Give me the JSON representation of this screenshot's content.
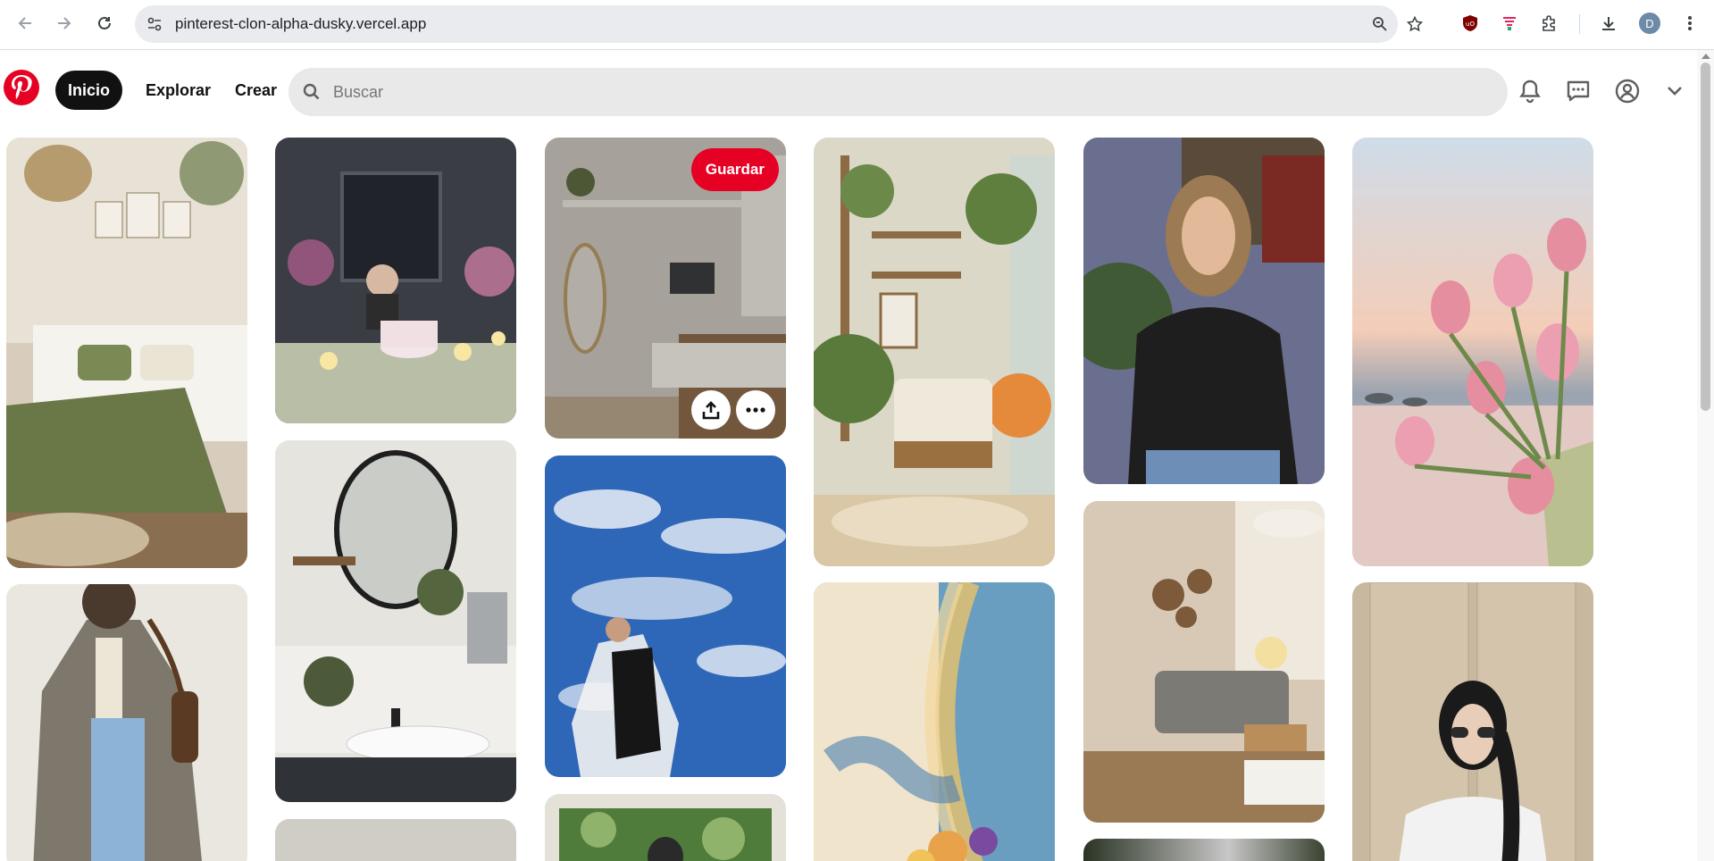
{
  "browser": {
    "url": "pinterest-clon-alpha-dusky.vercel.app",
    "profile_initial": "D"
  },
  "header": {
    "nav": [
      {
        "label": "Inicio",
        "active": true
      },
      {
        "label": "Explorar",
        "active": false
      },
      {
        "label": "Crear",
        "active": false
      }
    ],
    "search_placeholder": "Buscar"
  },
  "pins": {
    "save_label": "Guardar",
    "items": [
      {
        "id": 1,
        "subject": "bedroom",
        "colors": [
          "#d8cdbd",
          "#6a7848"
        ]
      },
      {
        "id": 2,
        "subject": "birthday-cake",
        "colors": [
          "#3a3d44",
          "#b9bfa6"
        ]
      },
      {
        "id": 3,
        "subject": "bedroom-shelves",
        "colors": [
          "#cbc6bd",
          "#8d6b4a"
        ]
      },
      {
        "id": 4,
        "subject": "reading-nook",
        "colors": [
          "#dcd8c8",
          "#8c6a44"
        ]
      },
      {
        "id": 5,
        "subject": "woman-portrait",
        "colors": [
          "#6a6f8f",
          "#1e1e1e"
        ]
      },
      {
        "id": 6,
        "subject": "pink-tulips",
        "colors": [
          "#e7d6d4",
          "#e58ea0"
        ]
      },
      {
        "id": 7,
        "subject": "bathroom-mirror",
        "colors": [
          "#e6e4df",
          "#4c5a3a"
        ]
      },
      {
        "id": 8,
        "subject": "sky-clouds",
        "colors": [
          "#2f67b8",
          "#eaf0f8"
        ]
      },
      {
        "id": 9,
        "subject": "living-room",
        "colors": [
          "#d7c9b5",
          "#7c6a55"
        ]
      },
      {
        "id": 10,
        "subject": "fashion-blazer",
        "colors": [
          "#e9e7df",
          "#8db3d6"
        ]
      },
      {
        "id": 11,
        "subject": "rainbow-flowers",
        "colors": [
          "#6a9ec0",
          "#e9c36a"
        ]
      },
      {
        "id": 12,
        "subject": "fashion-sunglasses",
        "colors": [
          "#c8b8a0",
          "#f2f2f2"
        ]
      },
      {
        "id": 13,
        "subject": "pin-partial",
        "colors": [
          "#d0cdc6",
          "#bfbcb5"
        ]
      },
      {
        "id": 14,
        "subject": "pin-partial-green",
        "colors": [
          "#4f7c3a",
          "#8fb36a"
        ]
      },
      {
        "id": 15,
        "subject": "pin-partial-dark",
        "colors": [
          "#2a3324",
          "#c7c7c7"
        ]
      }
    ]
  }
}
